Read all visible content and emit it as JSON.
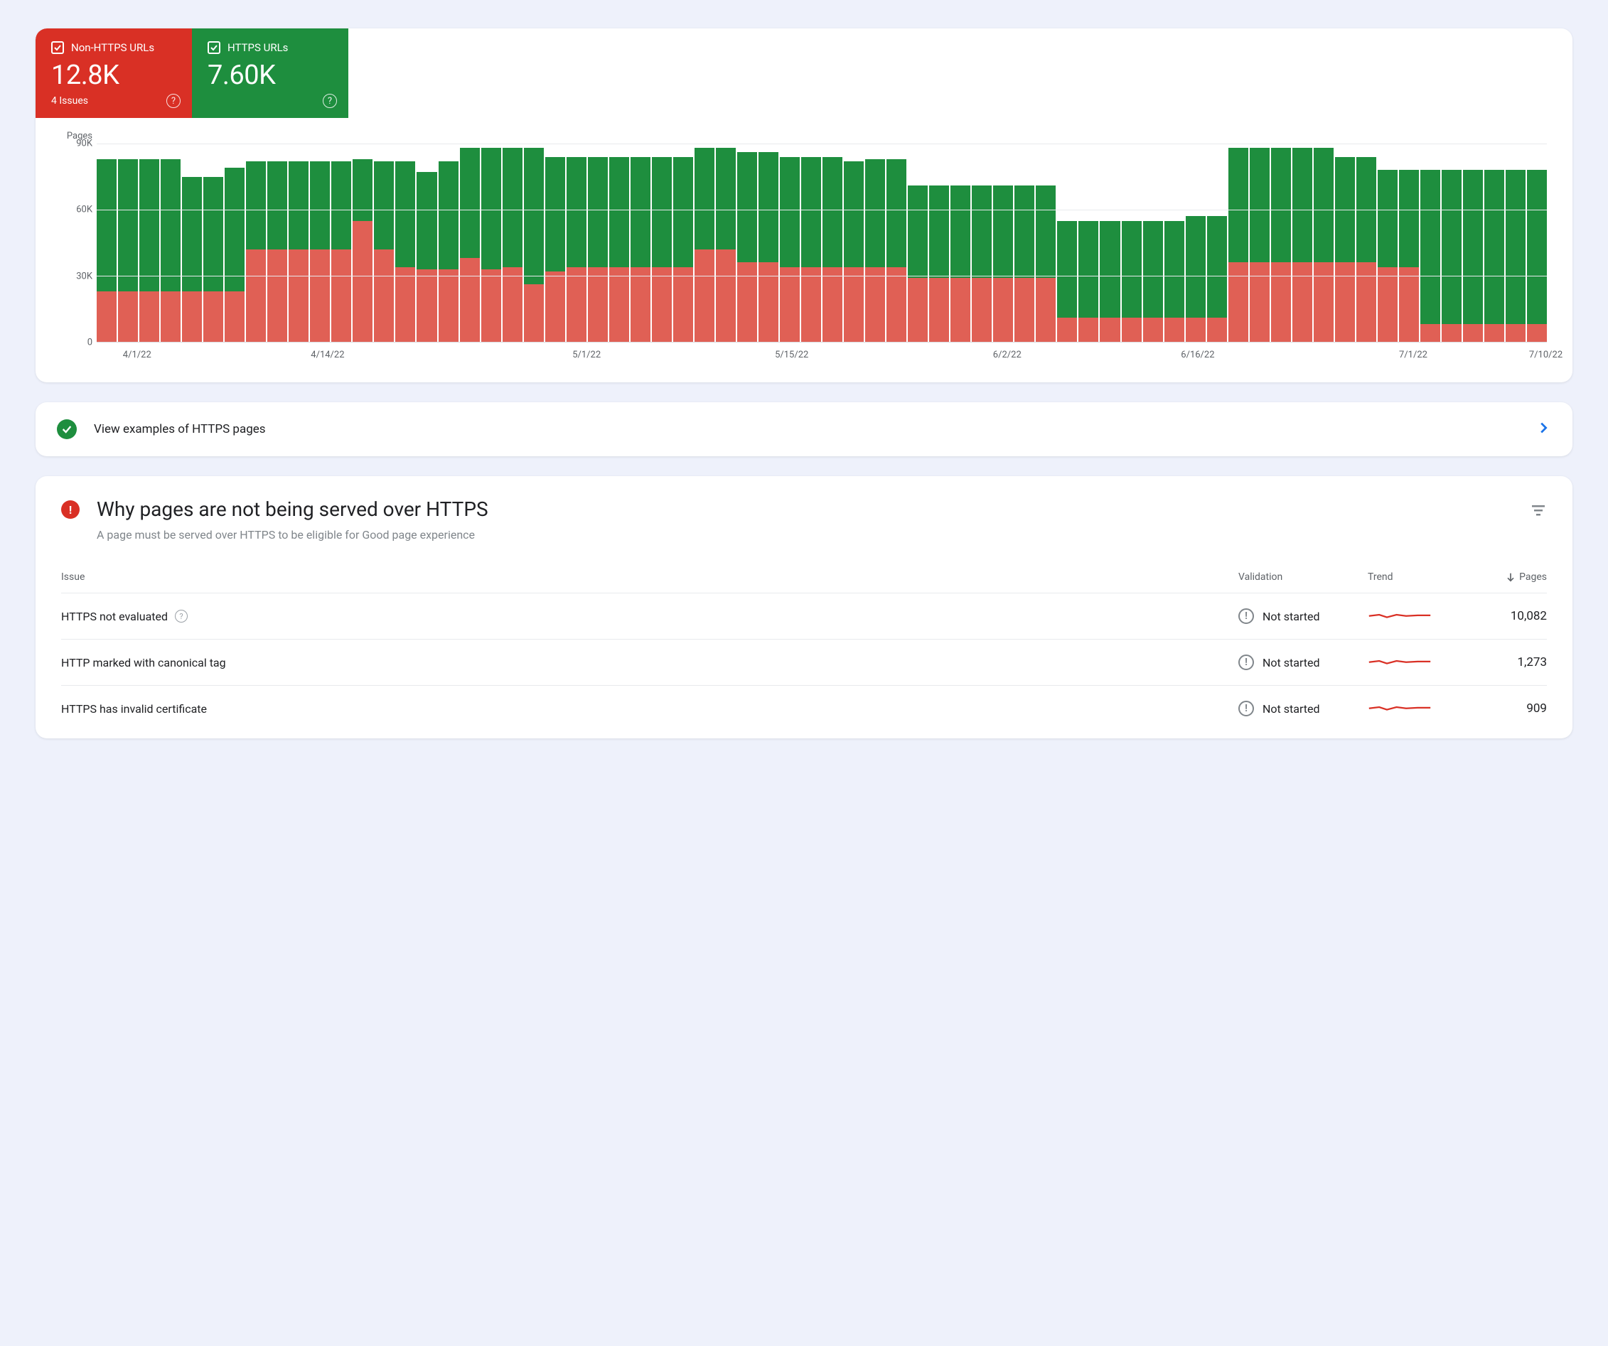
{
  "colors": {
    "red": "#d93025",
    "green": "#1e8e3e",
    "barRed": "#e06055",
    "blue": "#1a73e8"
  },
  "summary": {
    "tiles": [
      {
        "label": "Non-HTTPS URLs",
        "value": "12.8K",
        "issues": "4 Issues",
        "kind": "red"
      },
      {
        "label": "HTTPS URLs",
        "value": "7.60K",
        "issues": "",
        "kind": "green"
      }
    ]
  },
  "chart_data": {
    "type": "bar",
    "title": "",
    "ylabel": "Pages",
    "ylim": [
      0,
      90000
    ],
    "y_ticks": [
      0,
      30000,
      60000,
      90000
    ],
    "y_tick_labels": [
      "0",
      "30K",
      "60K",
      "90K"
    ],
    "x_tick_labels": [
      "4/1/22",
      "4/14/22",
      "5/1/22",
      "5/15/22",
      "6/2/22",
      "6/16/22",
      "7/1/22",
      "7/10/22"
    ],
    "x_tick_positions_pct": [
      2,
      15,
      33,
      47,
      62,
      75,
      90,
      99
    ],
    "stacked": true,
    "series": [
      {
        "name": "Non-HTTPS URLs",
        "color": "#e06055",
        "values": [
          23000,
          23000,
          23000,
          23000,
          23000,
          23000,
          23000,
          42000,
          42000,
          42000,
          42000,
          42000,
          55000,
          42000,
          34000,
          33000,
          33000,
          38000,
          33000,
          34000,
          26000,
          32000,
          34000,
          34000,
          34000,
          34000,
          34000,
          34000,
          42000,
          42000,
          36000,
          36000,
          34000,
          34000,
          34000,
          34000,
          34000,
          34000,
          29000,
          29000,
          29000,
          29000,
          29000,
          29000,
          29000,
          11000,
          11000,
          11000,
          11000,
          11000,
          11000,
          11000,
          11000,
          36000,
          36000,
          36000,
          36000,
          36000,
          36000,
          36000,
          34000,
          34000,
          8000,
          8000,
          8000,
          8000,
          8000,
          8000
        ]
      },
      {
        "name": "HTTPS URLs",
        "color": "#1e8e3e",
        "values": [
          60000,
          60000,
          60000,
          60000,
          52000,
          52000,
          56000,
          40000,
          40000,
          40000,
          40000,
          40000,
          28000,
          40000,
          48000,
          44000,
          49000,
          50000,
          55000,
          54000,
          62000,
          52000,
          50000,
          50000,
          50000,
          50000,
          50000,
          50000,
          46000,
          46000,
          50000,
          50000,
          50000,
          50000,
          50000,
          48000,
          49000,
          49000,
          42000,
          42000,
          42000,
          42000,
          42000,
          42000,
          42000,
          44000,
          44000,
          44000,
          44000,
          44000,
          44000,
          46000,
          46000,
          52000,
          52000,
          52000,
          52000,
          52000,
          48000,
          48000,
          44000,
          44000,
          70000,
          70000,
          70000,
          70000,
          70000,
          70000
        ]
      }
    ]
  },
  "examples_link": {
    "text": "View examples of HTTPS pages"
  },
  "issues": {
    "title": "Why pages are not being served over HTTPS",
    "subtitle": "A page must be served over HTTPS to be eligible for Good page experience",
    "columns": {
      "issue": "Issue",
      "validation": "Validation",
      "trend": "Trend",
      "pages": "Pages"
    },
    "rows": [
      {
        "name": "HTTPS not evaluated",
        "help": true,
        "validation": "Not started",
        "pages": "10,082"
      },
      {
        "name": "HTTP marked with canonical tag",
        "help": false,
        "validation": "Not started",
        "pages": "1,273"
      },
      {
        "name": "HTTPS has invalid certificate",
        "help": false,
        "validation": "Not started",
        "pages": "909"
      }
    ]
  }
}
